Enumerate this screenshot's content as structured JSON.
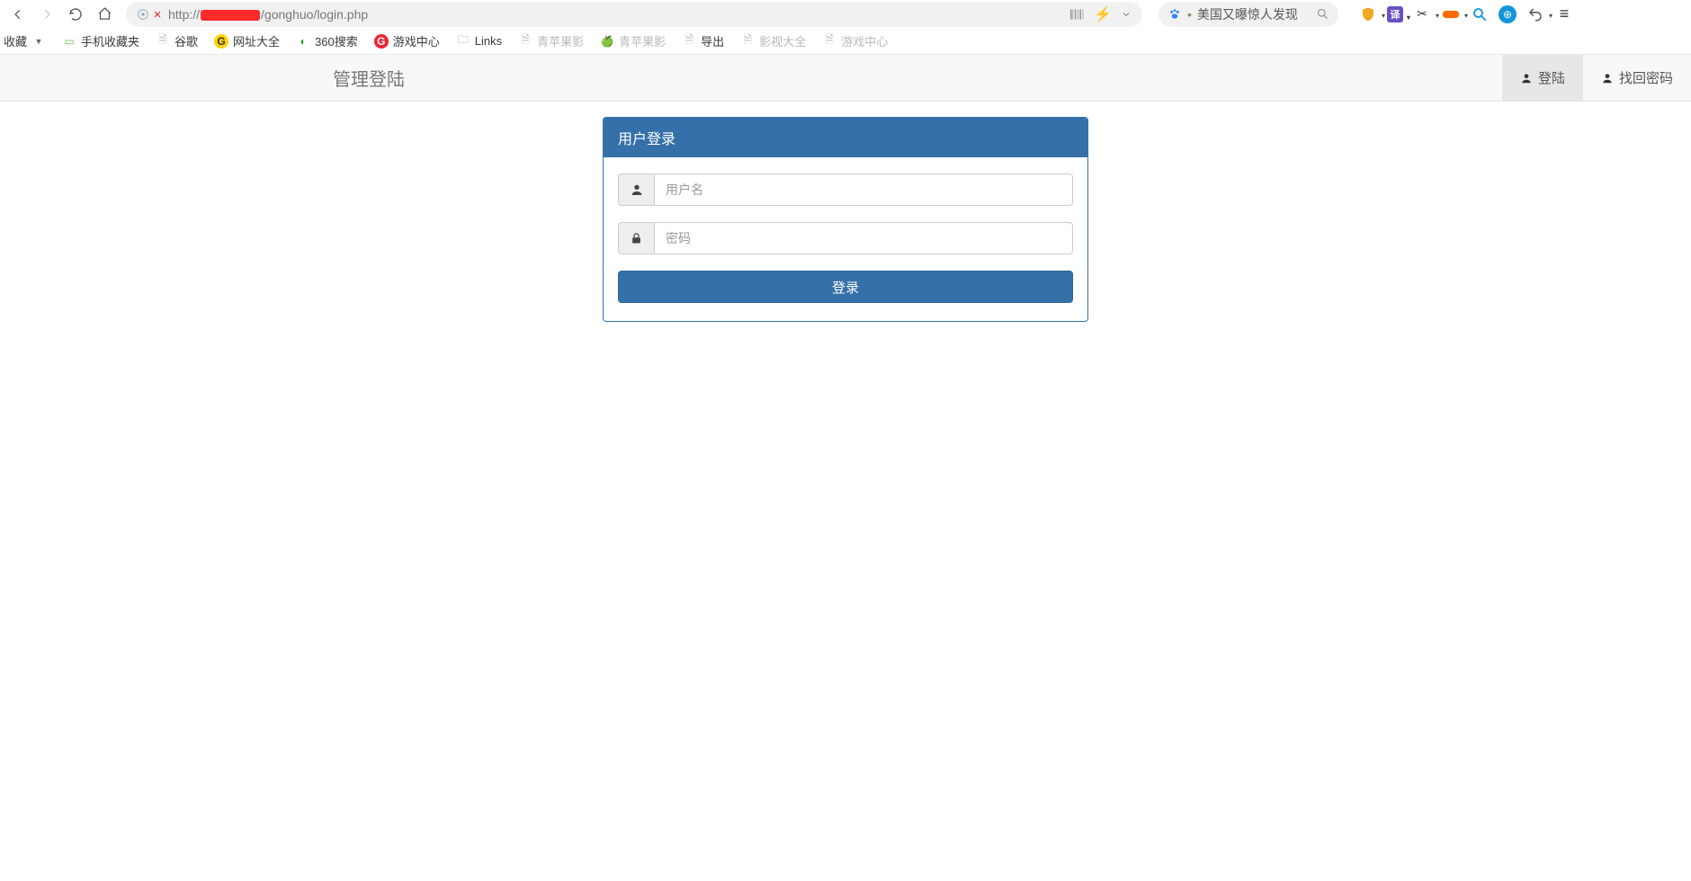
{
  "browser": {
    "url_prefix": "http://",
    "url_suffix": "/gonghuo/login.php",
    "news_text": "美国又曝惊人发现"
  },
  "bookmarks": {
    "fav_label": "收藏",
    "items": [
      {
        "label": "手机收藏夹"
      },
      {
        "label": "谷歌"
      },
      {
        "label": "网址大全"
      },
      {
        "label": "360搜索"
      },
      {
        "label": "游戏中心"
      },
      {
        "label": "Links"
      },
      {
        "label": "青苹果影"
      },
      {
        "label": "青苹果影"
      },
      {
        "label": "导出"
      },
      {
        "label": "影视大全"
      },
      {
        "label": "游戏中心"
      }
    ]
  },
  "page": {
    "brand": "管理登陆",
    "nav_login": "登陆",
    "nav_find": "找回密码"
  },
  "login": {
    "title": "用户登录",
    "username_placeholder": "用户名",
    "password_placeholder": "密码",
    "submit": "登录"
  }
}
